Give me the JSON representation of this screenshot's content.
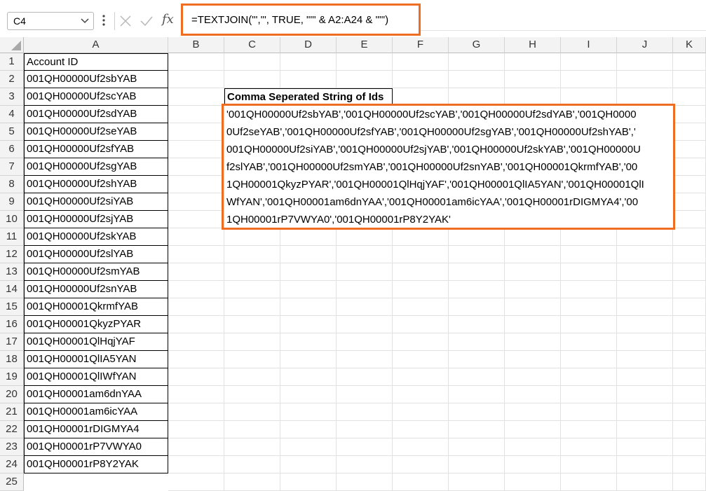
{
  "name_box": {
    "value": "C4"
  },
  "formula_bar": {
    "formula": "=TEXTJOIN(\"','\", TRUE, \"'\" & A2:A24 & \"'\")",
    "fx_label": "fx"
  },
  "columns": [
    "A",
    "B",
    "C",
    "D",
    "E",
    "F",
    "G",
    "H",
    "I",
    "J",
    "K"
  ],
  "rows": [
    "1",
    "2",
    "3",
    "4",
    "5",
    "6",
    "7",
    "8",
    "9",
    "10",
    "11",
    "12",
    "13",
    "14",
    "15",
    "16",
    "17",
    "18",
    "19",
    "20",
    "21",
    "22",
    "23",
    "24",
    "25"
  ],
  "column_a": [
    "Account ID",
    "001QH00000Uf2sbYAB",
    "001QH00000Uf2scYAB",
    "001QH00000Uf2sdYAB",
    "001QH00000Uf2seYAB",
    "001QH00000Uf2sfYAB",
    "001QH00000Uf2sgYAB",
    "001QH00000Uf2shYAB",
    "001QH00000Uf2siYAB",
    "001QH00000Uf2sjYAB",
    "001QH00000Uf2skYAB",
    "001QH00000Uf2slYAB",
    "001QH00000Uf2smYAB",
    "001QH00000Uf2snYAB",
    "001QH00001QkrmfYAB",
    "001QH00001QkyzPYAR",
    "001QH00001QlHqjYAF",
    "001QH00001QlIA5YAN",
    "001QH00001QlIWfYAN",
    "001QH00001am6dnYAA",
    "001QH00001am6icYAA",
    "001QH00001rDIGMYA4",
    "001QH00001rP7VWYA0",
    "001QH00001rP8Y2YAK"
  ],
  "result_header": "Comma Seperated String of Ids",
  "result_lines": [
    "'001QH00000Uf2sbYAB','001QH00000Uf2scYAB','001QH00000Uf2sdYAB','001QH0000",
    "0Uf2seYAB','001QH00000Uf2sfYAB','001QH00000Uf2sgYAB','001QH00000Uf2shYAB','",
    "001QH00000Uf2siYAB','001QH00000Uf2sjYAB','001QH00000Uf2skYAB','001QH00000U",
    "f2slYAB','001QH00000Uf2smYAB','001QH00000Uf2snYAB','001QH00001QkrmfYAB','00",
    "1QH00001QkyzPYAR','001QH00001QlHqjYAF','001QH00001QlIA5YAN','001QH00001QlI",
    "WfYAN','001QH00001am6dnYAA','001QH00001am6icYAA','001QH00001rDIGMYA4','00",
    "1QH00001rP7VWYA0','001QH00001rP8Y2YAK'"
  ],
  "colors": {
    "highlight": "#ef6d22",
    "header_bg": "#f3f3f3",
    "gridline": "#e1e1e1"
  }
}
